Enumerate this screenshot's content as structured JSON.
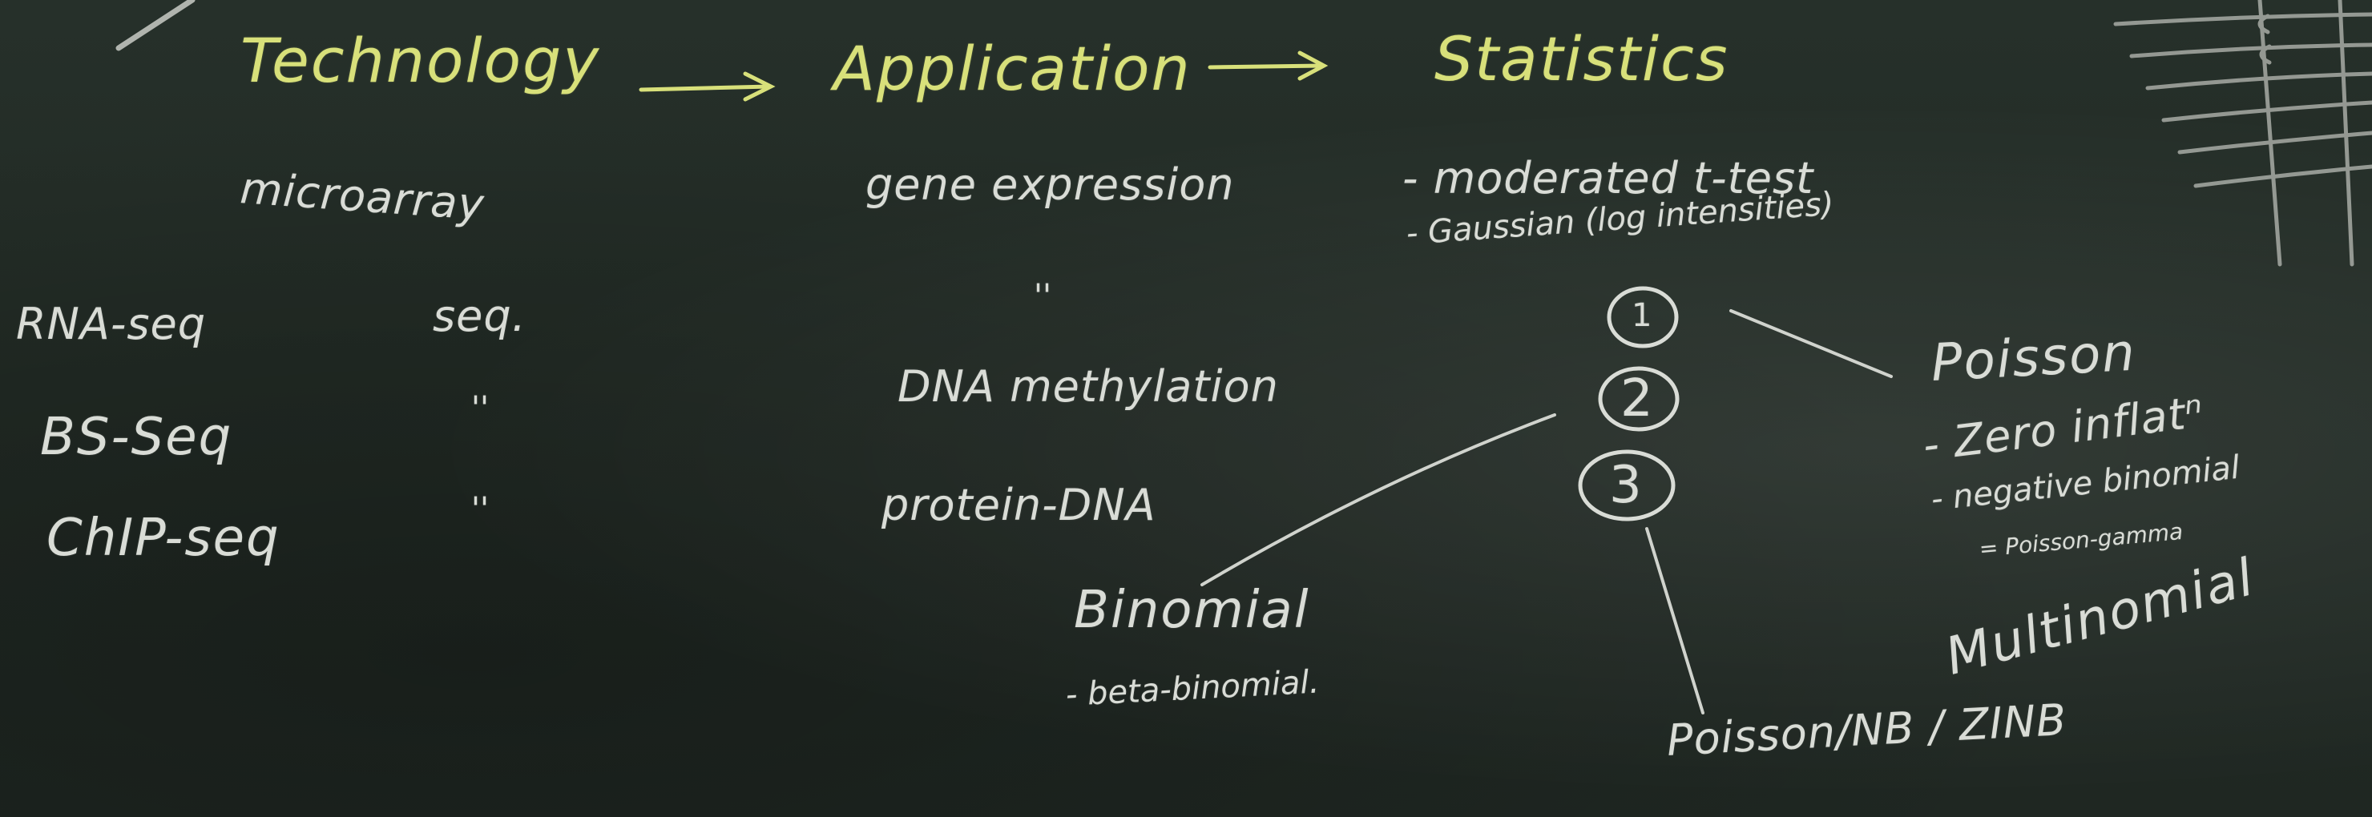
{
  "board": {
    "headers": {
      "technology": "Technology",
      "application": "Application",
      "statistics": "Statistics"
    },
    "technologies": {
      "microarray": "microarray",
      "rna_seq": "RNA-seq",
      "bs_seq": "BS-Seq",
      "chip_seq": "ChIP-seq",
      "seq": "seq.",
      "ditto1": "''",
      "ditto2": "''"
    },
    "applications": {
      "gene_expression": "gene expression",
      "ditto": "''",
      "dna_methylation": "DNA methylation",
      "protein_dna": "protein-DNA"
    },
    "statistics": {
      "moderated_t": "- moderated t-test",
      "gaussian": "- Gaussian (log intensities)",
      "n1": "1",
      "n2": "2",
      "n3": "3",
      "poisson": "Poisson",
      "zero_inflated": "- Zero inflatⁿ",
      "negative_binomial": "- negative binomial",
      "poisson_gamma": "= Poisson-gamma",
      "binomial": "Binomial",
      "beta_binomial": "- beta-binomial.",
      "poisson_nb_zinb": "Poisson/NB / ZINB",
      "multinomial": "Multinomial"
    },
    "colors": {
      "chalk": "#d9dcd6",
      "yellow_chalk": "#d8e07a",
      "board": "#222b25"
    }
  }
}
